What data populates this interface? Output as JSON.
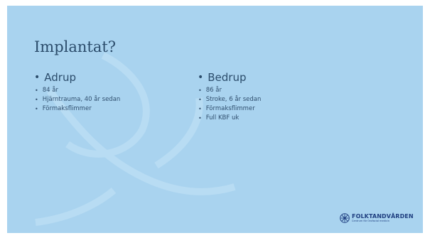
{
  "slide": {
    "title": "Implantat?",
    "columns": [
      {
        "heading": "Adrup",
        "items": [
          "84 år",
          "Hjärntrauma, 40 år sedan",
          "Förmaksflimmer"
        ]
      },
      {
        "heading": "Bedrup",
        "items": [
          "86 år",
          "Stroke, 6 år sedan",
          "Förmaksflimmer",
          "Full KBF uk"
        ]
      }
    ]
  },
  "footer": {
    "logo_name": "FOLKTANDVÅRDEN",
    "logo_subtitle": "Centrum för Orofacial medicin",
    "logo_icon": "folktandvarden-emblem-icon"
  },
  "colors": {
    "background": "#a9d3ef",
    "text": "#2b4c6b",
    "logo": "#1f3f80"
  }
}
